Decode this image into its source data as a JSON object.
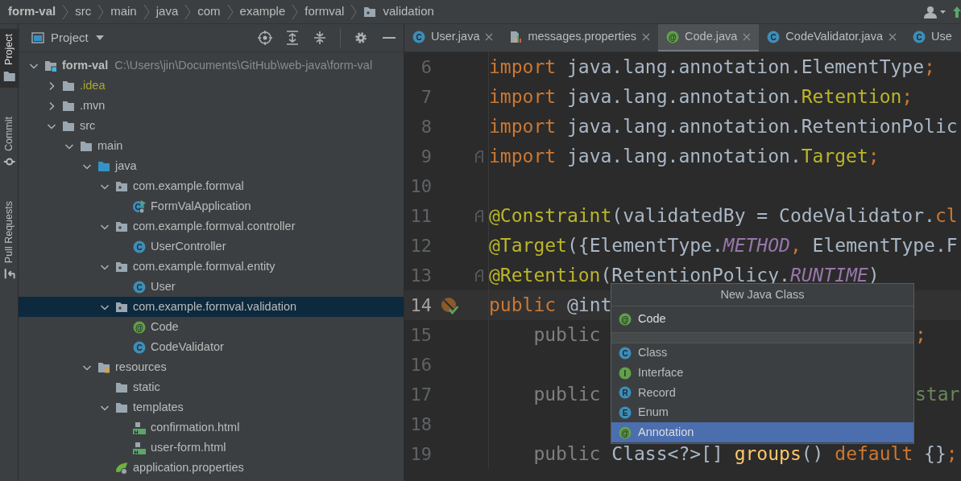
{
  "breadcrumb": [
    {
      "label": "form-val",
      "kind": "project"
    },
    {
      "label": "src",
      "kind": "dir"
    },
    {
      "label": "main",
      "kind": "dir"
    },
    {
      "label": "java",
      "kind": "dir"
    },
    {
      "label": "com",
      "kind": "dir"
    },
    {
      "label": "example",
      "kind": "dir"
    },
    {
      "label": "formval",
      "kind": "dir"
    },
    {
      "label": "validation",
      "kind": "package"
    }
  ],
  "side_tabs": [
    {
      "label": "Project",
      "kind": "project",
      "selected": true
    },
    {
      "label": "Commit",
      "kind": "commit",
      "selected": false
    },
    {
      "label": "Pull Requests",
      "kind": "pull",
      "selected": false
    }
  ],
  "project_panel": {
    "title": "Project"
  },
  "tree": [
    {
      "label": "form-val",
      "path": "C:\\Users\\jin\\Documents\\GitHub\\web-java\\form-val",
      "kind": "module",
      "expanded": true,
      "selected": false,
      "excluded": false,
      "children": [
        {
          "label": ".idea",
          "kind": "folder",
          "expanded": false,
          "selected": false,
          "excluded": true
        },
        {
          "label": ".mvn",
          "kind": "folder",
          "expanded": false,
          "selected": false,
          "excluded": false
        },
        {
          "label": "src",
          "kind": "folder",
          "expanded": true,
          "selected": false,
          "excluded": false,
          "children": [
            {
              "label": "main",
              "kind": "folder",
              "expanded": true,
              "selected": false,
              "excluded": false,
              "children": [
                {
                  "label": "java",
                  "kind": "source",
                  "expanded": true,
                  "selected": false,
                  "excluded": false,
                  "children": [
                    {
                      "label": "com.example.formval",
                      "kind": "package",
                      "expanded": true,
                      "selected": false,
                      "excluded": false,
                      "children": [
                        {
                          "label": "FormValApplication",
                          "kind": "spring-class",
                          "glyph": "C",
                          "selected": false,
                          "excluded": false
                        }
                      ]
                    },
                    {
                      "label": "com.example.formval.controller",
                      "kind": "package",
                      "expanded": true,
                      "selected": false,
                      "excluded": false,
                      "children": [
                        {
                          "label": "UserController",
                          "kind": "class",
                          "glyph": "C",
                          "selected": false,
                          "excluded": false
                        }
                      ]
                    },
                    {
                      "label": "com.example.formval.entity",
                      "kind": "package",
                      "expanded": true,
                      "selected": false,
                      "excluded": false,
                      "children": [
                        {
                          "label": "User",
                          "kind": "class",
                          "glyph": "C",
                          "selected": false,
                          "excluded": false
                        }
                      ]
                    },
                    {
                      "label": "com.example.formval.validation",
                      "kind": "package",
                      "expanded": true,
                      "selected": true,
                      "excluded": false,
                      "children": [
                        {
                          "label": "Code",
                          "kind": "annotation",
                          "glyph": "@",
                          "selected": false,
                          "excluded": false
                        },
                        {
                          "label": "CodeValidator",
                          "kind": "class",
                          "glyph": "C",
                          "selected": false,
                          "excluded": false
                        }
                      ]
                    }
                  ]
                },
                {
                  "label": "resources",
                  "kind": "resources",
                  "expanded": true,
                  "selected": false,
                  "excluded": false,
                  "children": [
                    {
                      "label": "static",
                      "kind": "folder",
                      "selected": false,
                      "excluded": false
                    },
                    {
                      "label": "templates",
                      "kind": "folder",
                      "expanded": true,
                      "selected": false,
                      "excluded": false,
                      "children": [
                        {
                          "label": "confirmation.html",
                          "kind": "html",
                          "glyph": "H",
                          "selected": false,
                          "excluded": false
                        },
                        {
                          "label": "user-form.html",
                          "kind": "html",
                          "glyph": "H",
                          "selected": false,
                          "excluded": false
                        }
                      ]
                    },
                    {
                      "label": "application.properties",
                      "kind": "spring-props",
                      "selected": false,
                      "excluded": false
                    }
                  ]
                }
              ]
            }
          ]
        }
      ]
    }
  ],
  "tabs": [
    {
      "label": "User.java",
      "kind": "class",
      "glyph": "C",
      "selected": false
    },
    {
      "label": "messages.properties",
      "kind": "properties",
      "selected": false
    },
    {
      "label": "Code.java",
      "kind": "annotation",
      "glyph": "@",
      "selected": true
    },
    {
      "label": "CodeValidator.java",
      "kind": "class",
      "glyph": "C",
      "selected": false
    },
    {
      "label": "Use",
      "kind": "class",
      "glyph": "C",
      "selected": false
    }
  ],
  "code_lines": [
    {
      "number": "6",
      "current": false,
      "fold": false,
      "implemented": false,
      "segments": [
        {
          "text": "import",
          "kind": "keyword"
        },
        {
          "text": " java.lang.annotation.ElementType",
          "kind": "plain"
        },
        {
          "text": ";",
          "kind": "keyword"
        }
      ]
    },
    {
      "number": "7",
      "current": false,
      "fold": false,
      "implemented": false,
      "segments": [
        {
          "text": "import",
          "kind": "keyword"
        },
        {
          "text": " java.lang.annotation.",
          "kind": "plain"
        },
        {
          "text": "Retention",
          "kind": "annotation"
        },
        {
          "text": ";",
          "kind": "keyword"
        }
      ]
    },
    {
      "number": "8",
      "current": false,
      "fold": false,
      "implemented": false,
      "segments": [
        {
          "text": "import",
          "kind": "keyword"
        },
        {
          "text": " java.lang.annotation.RetentionPolic",
          "kind": "plain"
        }
      ]
    },
    {
      "number": "9",
      "current": false,
      "fold": true,
      "implemented": false,
      "segments": [
        {
          "text": "import",
          "kind": "keyword"
        },
        {
          "text": " java.lang.annotation.",
          "kind": "plain"
        },
        {
          "text": "Target",
          "kind": "annotation"
        },
        {
          "text": ";",
          "kind": "keyword"
        }
      ]
    },
    {
      "number": "10",
      "current": false,
      "fold": false,
      "implemented": false
    },
    {
      "number": "11",
      "current": false,
      "fold": true,
      "implemented": false,
      "segments": [
        {
          "text": "@Constraint",
          "kind": "annotation"
        },
        {
          "text": "(validatedBy = CodeValidator.",
          "kind": "plain"
        },
        {
          "text": "cl",
          "kind": "keyword"
        }
      ]
    },
    {
      "number": "12",
      "current": false,
      "fold": false,
      "implemented": false,
      "segments": [
        {
          "text": "@Target",
          "kind": "annotation"
        },
        {
          "text": "({ElementType.",
          "kind": "plain"
        },
        {
          "text": "METHOD",
          "kind": "constant"
        },
        {
          "text": ", ",
          "kind": "keyword"
        },
        {
          "text": "ElementType.F",
          "kind": "plain"
        }
      ]
    },
    {
      "number": "13",
      "current": false,
      "fold": true,
      "implemented": false,
      "segments": [
        {
          "text": "@Retention",
          "kind": "annotation"
        },
        {
          "text": "(RetentionPolicy.",
          "kind": "plain"
        },
        {
          "text": "RUNTIME",
          "kind": "constant"
        },
        {
          "text": ")",
          "kind": "plain"
        }
      ]
    },
    {
      "number": "14",
      "current": true,
      "fold": false,
      "implemented": true,
      "segments": [
        {
          "text": "public",
          "kind": "keyword"
        },
        {
          "text": " @int",
          "kind": "plain"
        }
      ]
    },
    {
      "number": "15",
      "current": false,
      "fold": false,
      "implemented": false,
      "segments": [
        {
          "text": "    public",
          "kind": "dim"
        },
        {
          "text": ";",
          "kind": "keyword",
          "after_popup": true
        }
      ]
    },
    {
      "number": "16",
      "current": false,
      "fold": false,
      "implemented": false
    },
    {
      "number": "17",
      "current": false,
      "fold": false,
      "implemented": false,
      "segments": [
        {
          "text": "    public",
          "kind": "dim"
        },
        {
          "text": "star",
          "kind": "string",
          "after_popup": true
        }
      ]
    },
    {
      "number": "18",
      "current": false,
      "fold": false,
      "implemented": false
    },
    {
      "number": "19",
      "current": false,
      "fold": false,
      "implemented": false,
      "segments": [
        {
          "text": "    public ",
          "kind": "dim"
        },
        {
          "text": "Class<?>[] ",
          "kind": "plain"
        },
        {
          "text": "groups",
          "kind": "method"
        },
        {
          "text": "() ",
          "kind": "plain"
        },
        {
          "text": "default",
          "kind": "keyword"
        },
        {
          "text": " {}",
          "kind": "plain"
        },
        {
          "text": ";",
          "kind": "keyword"
        }
      ]
    }
  ],
  "popup": {
    "title": "New Java Class",
    "input": {
      "value": "Code",
      "kind": "annotation",
      "glyph": "@"
    },
    "options": [
      {
        "label": "Class",
        "kind": "class",
        "glyph": "C",
        "selected": false
      },
      {
        "label": "Interface",
        "kind": "interface",
        "glyph": "I",
        "selected": false
      },
      {
        "label": "Record",
        "kind": "record",
        "glyph": "R",
        "selected": false
      },
      {
        "label": "Enum",
        "kind": "enum",
        "glyph": "E",
        "selected": false
      },
      {
        "label": "Annotation",
        "kind": "annotation",
        "glyph": "@",
        "selected": true
      }
    ]
  }
}
